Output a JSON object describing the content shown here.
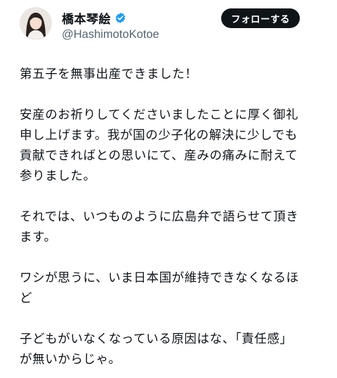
{
  "profile": {
    "display_name": "橋本琴絵",
    "handle": "@HashimotoKotoe",
    "verified_icon": "verified-badge-icon",
    "verified_color": "#1d9bf0"
  },
  "actions": {
    "follow_label": "フォローする"
  },
  "tweet": {
    "paragraphs": [
      {
        "lines": [
          "第五子を無事出産できました！"
        ]
      },
      {
        "lines": [
          "安産のお祈りしてくださいましたことに厚く御礼",
          "申し上げます。我が国の少子化の解決に少しでも",
          "貢献できればとの思いにて、産みの痛みに耐えて",
          "参りました。"
        ]
      },
      {
        "lines": [
          "それでは、いつものように広島弁で語らせて頂き",
          "ます。"
        ]
      },
      {
        "lines": [
          "ワシが思うに、いま日本国が維持できなくなるほ",
          "ど"
        ]
      },
      {
        "lines": [
          "子どもがいなくなっている原因はな、「責任感」",
          "が無いからじゃ。"
        ]
      }
    ]
  },
  "colors": {
    "text": "#0f1419",
    "secondary_text": "#536471",
    "button_bg": "#0f1419",
    "button_text": "#ffffff"
  }
}
